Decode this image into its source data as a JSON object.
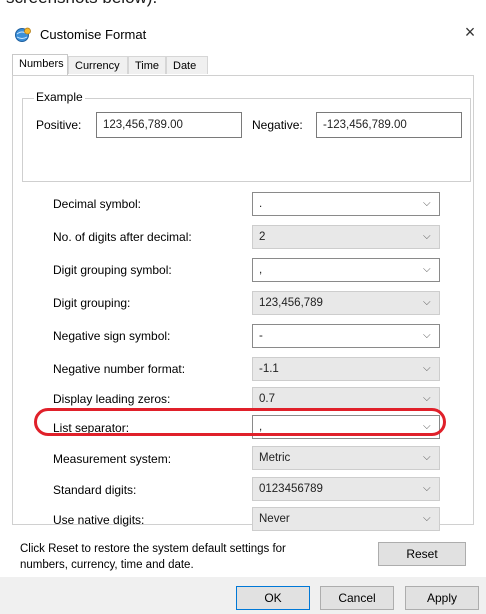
{
  "page_fragment": "screenshots below).",
  "dialog": {
    "title": "Customise Format",
    "close": "×"
  },
  "tabs": [
    "Numbers",
    "Currency",
    "Time",
    "Date"
  ],
  "example": {
    "legend": "Example",
    "positive_label": "Positive:",
    "positive_value": "123,456,789.00",
    "negative_label": "Negative:",
    "negative_value": "-123,456,789.00"
  },
  "settings": [
    {
      "label": "Decimal symbol:",
      "value": ".",
      "editable": true
    },
    {
      "label": "No. of digits after decimal:",
      "value": "2",
      "editable": false
    },
    {
      "label": "Digit grouping symbol:",
      "value": ",",
      "editable": true
    },
    {
      "label": "Digit grouping:",
      "value": "123,456,789",
      "editable": false
    },
    {
      "label": "Negative sign symbol:",
      "value": "-",
      "editable": true
    },
    {
      "label": "Negative number format:",
      "value": "-1.1",
      "editable": false
    },
    {
      "label": "Display leading zeros:",
      "value": "0.7",
      "editable": false
    },
    {
      "label": "List separator:",
      "value": ",",
      "editable": true
    },
    {
      "label": "Measurement system:",
      "value": "Metric",
      "editable": false
    },
    {
      "label": "Standard digits:",
      "value": "0123456789",
      "editable": false
    },
    {
      "label": "Use native digits:",
      "value": "Never",
      "editable": false
    }
  ],
  "footer": {
    "text": "Click Reset to restore the system default settings for numbers, currency, time and date.",
    "reset": "Reset"
  },
  "buttons": {
    "ok": "OK",
    "cancel": "Cancel",
    "apply": "Apply"
  },
  "colors": {
    "highlight": "#e0202a",
    "accent": "#0078d7"
  },
  "chevron": "⌵"
}
